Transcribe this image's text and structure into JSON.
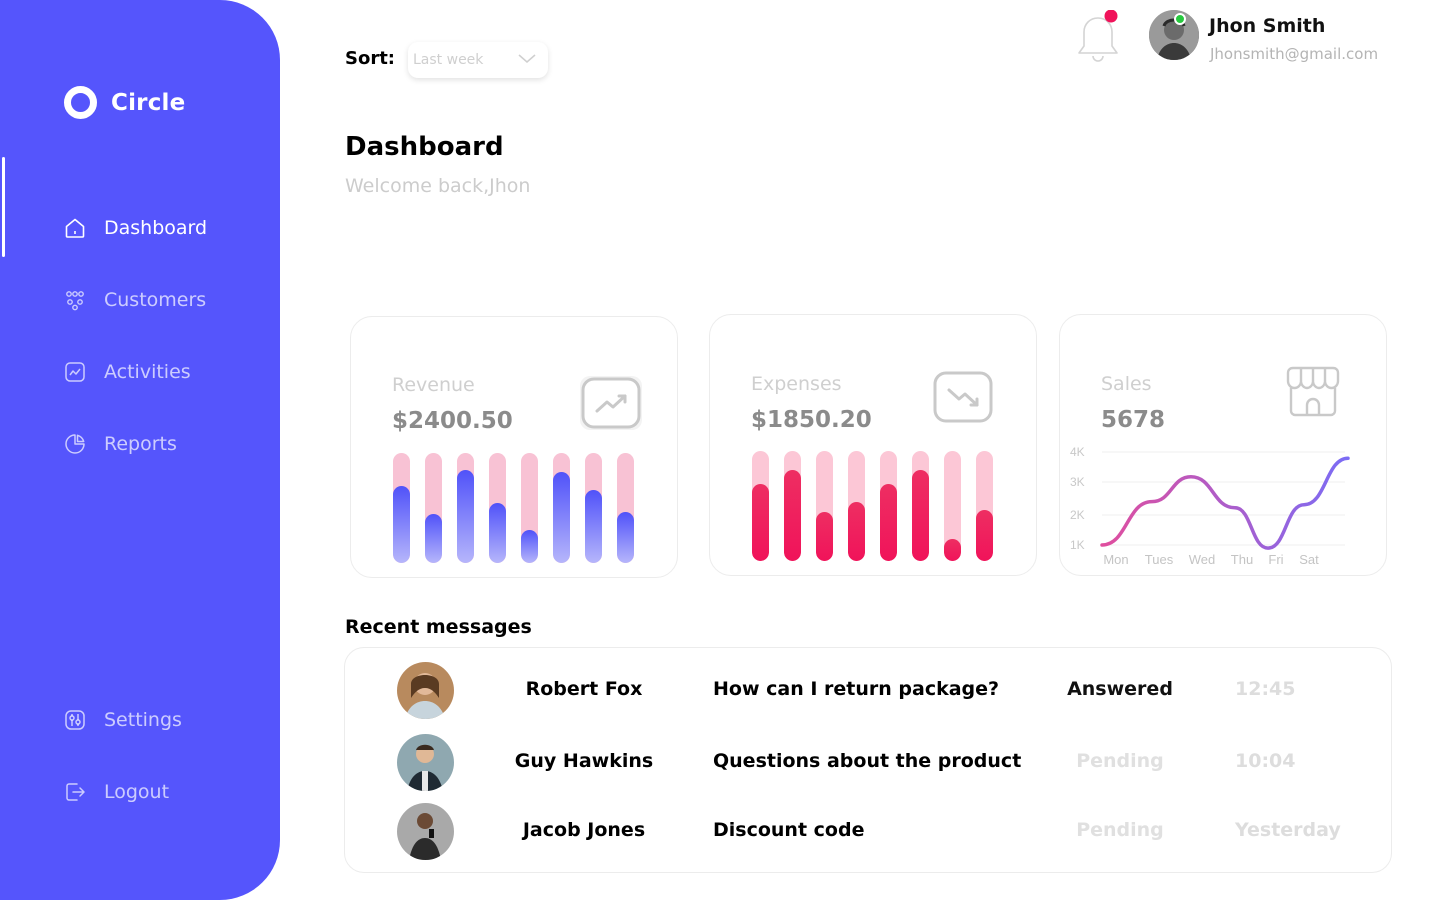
{
  "brand": {
    "name": "Circle"
  },
  "sidebar": {
    "items": [
      {
        "label": "Dashboard",
        "icon": "home-icon"
      },
      {
        "label": "Customers",
        "icon": "users-icon"
      },
      {
        "label": "Activities",
        "icon": "activity-icon"
      },
      {
        "label": "Reports",
        "icon": "pie-chart-icon"
      },
      {
        "label": "Settings",
        "icon": "settings-icon"
      },
      {
        "label": "Logout",
        "icon": "logout-icon"
      }
    ],
    "active": "Dashboard"
  },
  "topbar": {
    "sort_label": "Sort:",
    "sort_value": "Last week",
    "user_name": "Jhon Smith",
    "user_email": "Jhonsmith@gmail.com",
    "notification_dot": true
  },
  "page": {
    "title": "Dashboard",
    "subtitle": "Welcome back,Jhon"
  },
  "cards": {
    "revenue": {
      "title": "Revenue",
      "value": "$2400.50",
      "icon": "trending-up-icon",
      "bar_levels": [
        0.7,
        0.45,
        0.85,
        0.55,
        0.3,
        0.83,
        0.66,
        0.46
      ]
    },
    "expenses": {
      "title": "Expenses",
      "value": "$1850.20",
      "icon": "trending-down-icon",
      "bar_levels": [
        0.7,
        0.83,
        0.45,
        0.54,
        0.7,
        0.83,
        0.2,
        0.46
      ]
    },
    "sales": {
      "title": "Sales",
      "value": "5678",
      "icon": "store-icon"
    }
  },
  "colors": {
    "sidebar": "#5555FC",
    "revenue_bar": "#5052F9",
    "expense_bar": "#F0135A",
    "line_start": "#E04E9E",
    "line_end": "#7B6CF5"
  },
  "chart_data": {
    "type": "line",
    "categories": [
      "Mon",
      "Tues",
      "Wed",
      "Thu",
      "Fri",
      "Sat"
    ],
    "x": [
      "Mon",
      "Tues",
      "Wed",
      "Thu",
      "Fri",
      "Sat"
    ],
    "y_ticks": [
      "4K",
      "3K",
      "2K",
      "1K"
    ],
    "values": [
      1000,
      2400,
      3200,
      2200,
      900,
      2300,
      3800
    ],
    "ylim": [
      1000,
      4000
    ],
    "grid": true
  },
  "messages": {
    "title": "Recent messages",
    "rows": [
      {
        "name": "Robert Fox",
        "subject": "How can I return package?",
        "status": "Answered",
        "time": "12:45"
      },
      {
        "name": "Guy Hawkins",
        "subject": "Questions about the product",
        "status": "Pending",
        "time": "10:04"
      },
      {
        "name": "Jacob Jones",
        "subject": "Discount code",
        "status": "Pending",
        "time": "Yesterday"
      }
    ]
  }
}
